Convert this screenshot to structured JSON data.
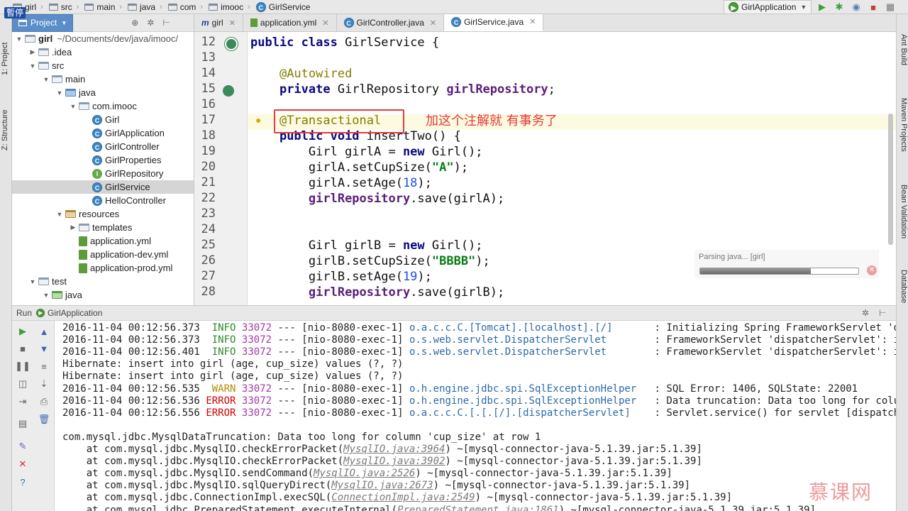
{
  "navbar": {
    "crumbs": [
      {
        "label": "girl",
        "icon": "folder-icon"
      },
      {
        "label": "src",
        "icon": "folder-icon"
      },
      {
        "label": "main",
        "icon": "folder-icon"
      },
      {
        "label": "java",
        "icon": "folder-icon"
      },
      {
        "label": "com",
        "icon": "folder-icon"
      },
      {
        "label": "imooc",
        "icon": "folder-icon"
      },
      {
        "label": "GirlService",
        "icon": "class-icon"
      }
    ],
    "pause_label": "暫停",
    "run_config": "GirlApplication"
  },
  "left_strip": {
    "project": "1: Project",
    "structure": "Z: Structure"
  },
  "right_strip": {
    "ant": "Ant Build",
    "maven": "Maven Projects",
    "bean": "Bean Validation",
    "database": "Database"
  },
  "project": {
    "tab_label": "Project",
    "root_label": "girl",
    "root_path": "~/Documents/dev/java/imooc/",
    "tree": [
      {
        "label": ".idea",
        "depth": 1,
        "arrow": "▶",
        "icon": "folder"
      },
      {
        "label": "src",
        "depth": 1,
        "arrow": "▼",
        "icon": "folder"
      },
      {
        "label": "main",
        "depth": 2,
        "arrow": "▼",
        "icon": "folder"
      },
      {
        "label": "java",
        "depth": 3,
        "arrow": "▼",
        "icon": "folder-blue"
      },
      {
        "label": "com.imooc",
        "depth": 4,
        "arrow": "▼",
        "icon": "folder"
      },
      {
        "label": "Girl",
        "depth": 5,
        "arrow": "",
        "icon": "class"
      },
      {
        "label": "GirlApplication",
        "depth": 5,
        "arrow": "",
        "icon": "class"
      },
      {
        "label": "GirlController",
        "depth": 5,
        "arrow": "",
        "icon": "class"
      },
      {
        "label": "GirlProperties",
        "depth": 5,
        "arrow": "",
        "icon": "class"
      },
      {
        "label": "GirlRepository",
        "depth": 5,
        "arrow": "",
        "icon": "interface"
      },
      {
        "label": "GirlService",
        "depth": 5,
        "arrow": "",
        "icon": "class",
        "selected": true
      },
      {
        "label": "HelloController",
        "depth": 5,
        "arrow": "",
        "icon": "class"
      },
      {
        "label": "resources",
        "depth": 3,
        "arrow": "▼",
        "icon": "folder-res"
      },
      {
        "label": "templates",
        "depth": 4,
        "arrow": "▶",
        "icon": "folder"
      },
      {
        "label": "application.yml",
        "depth": 4,
        "arrow": "",
        "icon": "yml"
      },
      {
        "label": "application-dev.yml",
        "depth": 4,
        "arrow": "",
        "icon": "yml"
      },
      {
        "label": "application-prod.yml",
        "depth": 4,
        "arrow": "",
        "icon": "yml"
      },
      {
        "label": "test",
        "depth": 1,
        "arrow": "▼",
        "icon": "folder"
      },
      {
        "label": "java",
        "depth": 2,
        "arrow": "▼",
        "icon": "folder-green"
      }
    ]
  },
  "editor": {
    "tabs": [
      {
        "label": "girl",
        "icon": "m",
        "active": false
      },
      {
        "label": "application.yml",
        "icon": "yml",
        "active": false
      },
      {
        "label": "GirlController.java",
        "icon": "class",
        "active": false
      },
      {
        "label": "GirlService.java",
        "icon": "class",
        "active": true
      }
    ],
    "line_numbers": [
      "12",
      "13",
      "14",
      "15",
      "16",
      "17",
      "18",
      "19",
      "20",
      "21",
      "22",
      "23",
      "24",
      "25",
      "26",
      "27",
      "28"
    ],
    "annotation_note": "加这个注解就  有事务了",
    "parsing_text": "Parsing java... [girl]",
    "parsing_progress": 0.7
  },
  "run": {
    "header_label": "Run",
    "header_config": "GirlApplication",
    "log": [
      {
        "ts": "2016-11-04 00:12:56.373",
        "lvl": "INFO",
        "pid": "33072",
        "thread": "--- [nio-8080-exec-1]",
        "logger": "o.a.c.c.C.[Tomcat].[localhost].[/]      ",
        "msg": ": Initializing Spring FrameworkServlet 'dispatc"
      },
      {
        "ts": "2016-11-04 00:12:56.373",
        "lvl": "INFO",
        "pid": "33072",
        "thread": "--- [nio-8080-exec-1]",
        "logger": "o.s.web.servlet.DispatcherServlet       ",
        "msg": ": FrameworkServlet 'dispatcherServlet': initial"
      },
      {
        "ts": "2016-11-04 00:12:56.401",
        "lvl": "INFO",
        "pid": "33072",
        "thread": "--- [nio-8080-exec-1]",
        "logger": "o.s.web.servlet.DispatcherServlet       ",
        "msg": ": FrameworkServlet 'dispatcherServlet': initial"
      },
      {
        "plain": "Hibernate: insert into girl (age, cup_size) values (?, ?)"
      },
      {
        "plain": "Hibernate: insert into girl (age, cup_size) values (?, ?)"
      },
      {
        "ts": "2016-11-04 00:12:56.535",
        "lvl": "WARN",
        "pid": "33072",
        "thread": "--- [nio-8080-exec-1]",
        "logger": "o.h.engine.jdbc.spi.SqlExceptionHelper  ",
        "msg": ": SQL Error: 1406, SQLState: 22001"
      },
      {
        "ts": "2016-11-04 00:12:56.536",
        "lvl": "ERROR",
        "pid": "33072",
        "thread": "--- [nio-8080-exec-1]",
        "logger": "o.h.engine.jdbc.spi.SqlExceptionHelper  ",
        "msg": ": Data truncation: Data too long for column 'cu"
      },
      {
        "ts": "2016-11-04 00:12:56.556",
        "lvl": "ERROR",
        "pid": "33072",
        "thread": "--- [nio-8080-exec-1]",
        "logger": "o.a.c.c.C.[.[.[/].[dispatcherServlet]   ",
        "msg": ": Servlet.service() for servlet [dispatcherServ"
      },
      {
        "plain": ""
      },
      {
        "plain": "com.mysql.jdbc.MysqlDataTruncation: Data too long for column 'cup_size' at row 1"
      },
      {
        "pre": "    at com.mysql.jdbc.MysqlIO.checkErrorPacket(",
        "link": "MysqlIO.java:3964",
        "post": ") ~[mysql-connector-java-5.1.39.jar:5.1.39]"
      },
      {
        "pre": "    at com.mysql.jdbc.MysqlIO.checkErrorPacket(",
        "link": "MysqlIO.java:3902",
        "post": ") ~[mysql-connector-java-5.1.39.jar:5.1.39]"
      },
      {
        "pre": "    at com.mysql.jdbc.MysqlIO.sendCommand(",
        "link": "MysqlIO.java:2526",
        "post": ") ~[mysql-connector-java-5.1.39.jar:5.1.39]"
      },
      {
        "pre": "    at com.mysql.jdbc.MysqlIO.sqlQueryDirect(",
        "link": "MysqlIO.java:2673",
        "post": ") ~[mysql-connector-java-5.1.39.jar:5.1.39]"
      },
      {
        "pre": "    at com.mysql.jdbc.ConnectionImpl.execSQL(",
        "link": "ConnectionImpl.java:2549",
        "post": ") ~[mysql-connector-java-5.1.39.jar:5.1.39]"
      },
      {
        "pre": "    at com.mysql.jdbc.PreparedStatement.executeInternal(",
        "link": "PreparedStatement.java:1861",
        "post": ") ~[mysql-connector-java-5.1.39.jar:5.1.39]"
      }
    ]
  },
  "watermark": "慕课网"
}
